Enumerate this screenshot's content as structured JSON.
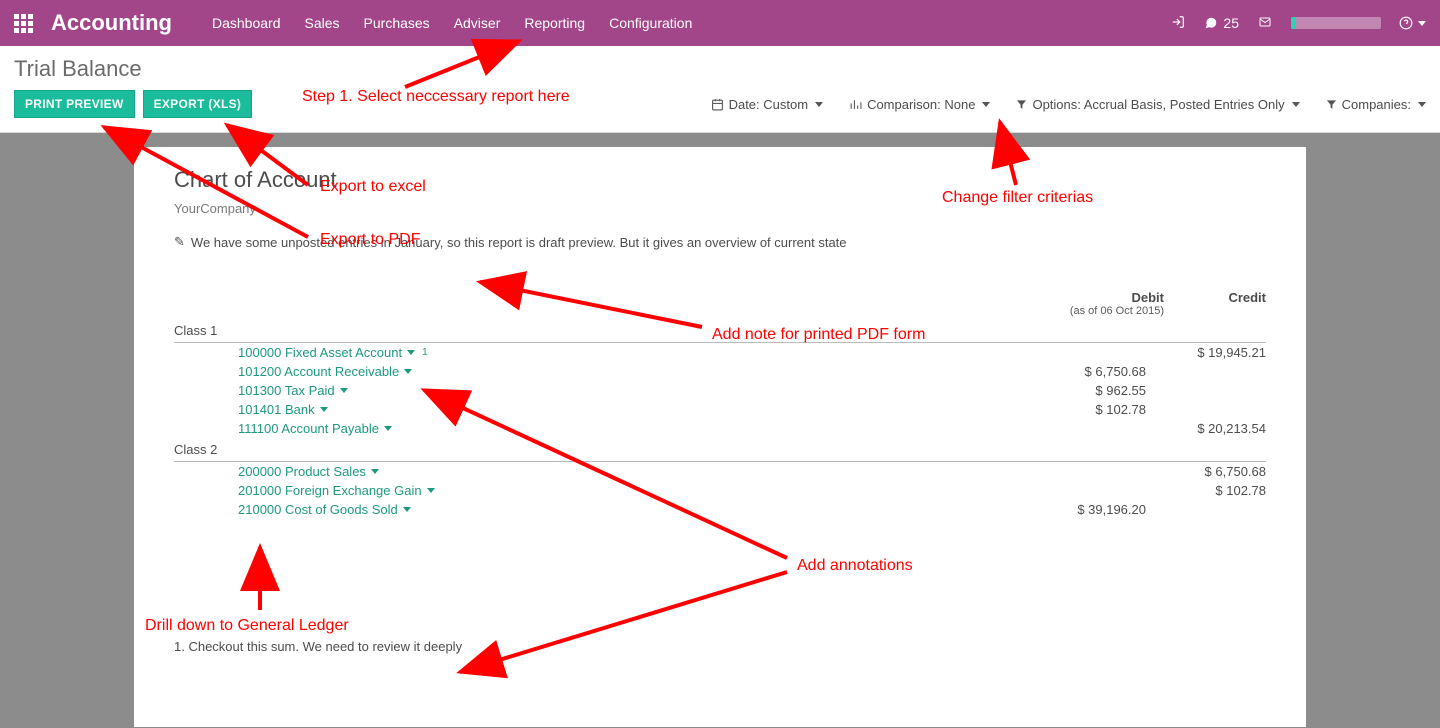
{
  "topbar": {
    "brand": "Accounting",
    "nav": [
      "Dashboard",
      "Sales",
      "Purchases",
      "Adviser",
      "Reporting",
      "Configuration"
    ],
    "messages_count": "25"
  },
  "page": {
    "title": "Trial Balance",
    "print_btn": "PRINT PREVIEW",
    "export_btn": "EXPORT (XLS)"
  },
  "filters": {
    "date": "Date: Custom",
    "comparison": "Comparison: None",
    "options": "Options: Accrual Basis, Posted Entries Only",
    "companies": "Companies:"
  },
  "report": {
    "title": "Chart of Account",
    "company": "YourCompany",
    "note_text": "We have some unposted entries in January, so this report is draft preview. But it gives an overview of current state",
    "debit_label": "Debit",
    "debit_sub": "(as of 06 Oct 2015)",
    "credit_label": "Credit",
    "class1_label": "Class 1",
    "class2_label": "Class 2",
    "class1": [
      {
        "name": "100000 Fixed Asset Account",
        "sup": "1",
        "debit": "",
        "credit": "$ 19,945.21"
      },
      {
        "name": "101200 Account Receivable",
        "debit": "$ 6,750.68",
        "credit": ""
      },
      {
        "name": "101300 Tax Paid",
        "debit": "$ 962.55",
        "credit": ""
      },
      {
        "name": "101401 Bank",
        "debit": "$ 102.78",
        "credit": ""
      },
      {
        "name": "111100 Account Payable",
        "debit": "",
        "credit": "$ 20,213.54"
      }
    ],
    "class2": [
      {
        "name": "200000 Product Sales",
        "debit": "",
        "credit": "$ 6,750.68"
      },
      {
        "name": "201000 Foreign Exchange Gain",
        "debit": "",
        "credit": "$ 102.78"
      },
      {
        "name": "210000 Cost of Goods Sold",
        "debit": "$ 39,196.20",
        "credit": ""
      }
    ],
    "footnote": "1. Checkout this sum. We need to review it deeply"
  },
  "annotations": {
    "step1": "Step 1. Select neccessary report here",
    "export_excel": "Export to excel",
    "export_pdf": "Export to PDF",
    "change_filters": "Change filter criterias",
    "add_note": "Add note for printed PDF form",
    "add_annotations": "Add annotations",
    "drill_down": "Drill down to General Ledger"
  }
}
